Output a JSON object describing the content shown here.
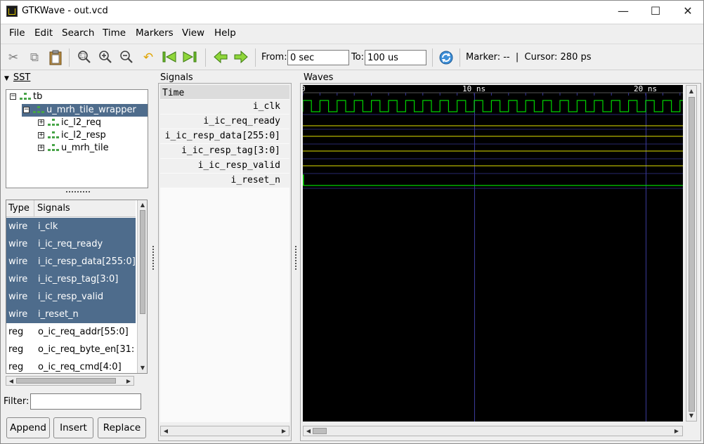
{
  "window": {
    "title": "GTKWave - out.vcd",
    "controls": {
      "minimize": "—",
      "maximize": "☐",
      "close": "✕"
    }
  },
  "menu": [
    "File",
    "Edit",
    "Search",
    "Time",
    "Markers",
    "View",
    "Help"
  ],
  "toolbar": {
    "icons": [
      "cut-icon",
      "copy-icon",
      "paste-icon",
      "zoom-fit-icon",
      "zoom-in-icon",
      "zoom-out-icon",
      "undo-icon",
      "jump-start-icon",
      "jump-end-icon",
      "prev-edge-icon",
      "next-edge-icon",
      "reload-icon"
    ],
    "from_label": "From:",
    "from_value": "0 sec",
    "to_label": "To:",
    "to_value": "100 us",
    "status": "Marker: --  |  Cursor: 280 ps"
  },
  "sst": {
    "title": "SST",
    "tree": [
      {
        "label": "tb",
        "expander": "−"
      },
      {
        "label": "u_mrh_tile_wrapper",
        "expander": "−",
        "selected": true
      },
      {
        "label": "ic_l2_req",
        "expander": "+"
      },
      {
        "label": "ic_l2_resp",
        "expander": "+"
      },
      {
        "label": "u_mrh_tile",
        "expander": "+"
      }
    ],
    "list_header": {
      "type": "Type",
      "signals": "Signals"
    },
    "list": [
      {
        "type": "wire",
        "name": "i_clk",
        "selected": true
      },
      {
        "type": "wire",
        "name": "i_ic_req_ready",
        "selected": true
      },
      {
        "type": "wire",
        "name": "i_ic_resp_data[255:0]",
        "selected": true
      },
      {
        "type": "wire",
        "name": "i_ic_resp_tag[3:0]",
        "selected": true
      },
      {
        "type": "wire",
        "name": "i_ic_resp_valid",
        "selected": true
      },
      {
        "type": "wire",
        "name": "i_reset_n",
        "selected": true
      },
      {
        "type": "reg",
        "name": "o_ic_req_addr[55:0]",
        "selected": false
      },
      {
        "type": "reg",
        "name": "o_ic_req_byte_en[31:",
        "selected": false
      },
      {
        "type": "reg",
        "name": "o_ic_req_cmd[4:0]",
        "selected": false
      }
    ],
    "filter_label": "Filter:",
    "filter_value": "",
    "buttons": {
      "append": "Append",
      "insert": "Insert",
      "replace": "Replace"
    }
  },
  "signals_panel": {
    "title": "Signals",
    "time_header": "Time",
    "names": [
      "i_clk",
      "i_ic_req_ready",
      "i_ic_resp_data[255:0]",
      "i_ic_resp_tag[3:0]",
      "i_ic_resp_valid",
      "i_reset_n"
    ]
  },
  "waves_panel": {
    "title": "Waves",
    "ruler": {
      "start": "0",
      "mark_10": "10 ns",
      "mark_20": "20 ns"
    },
    "colors": {
      "background": "#000000",
      "clock": "#00d400",
      "bus": "#e0e000",
      "grid": "#3a3a9a",
      "ruler_text": "#ffffff"
    }
  }
}
